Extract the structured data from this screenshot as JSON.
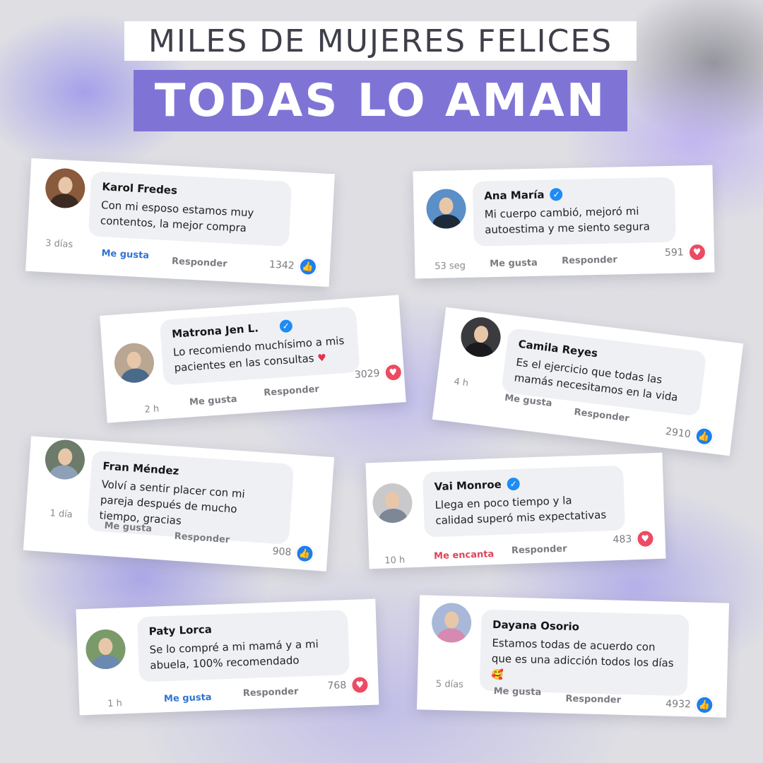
{
  "header": {
    "subtitle": "MILES DE MUJERES FELICES",
    "title": "TODAS LO AMAN"
  },
  "colors": {
    "accent": "#7f74d6",
    "like": "#1c7ef0",
    "love": "#ec4b63",
    "verified": "#1d8cf5"
  },
  "actions": {
    "like": "Me gusta",
    "love": "Me encanta",
    "reply": "Responder"
  },
  "comments": [
    {
      "name": "Karol Fredes",
      "verified": false,
      "text": "Con mi esposo estamos muy contentos, la mejor compra",
      "emoji": "",
      "time": "3 días",
      "action_label": "Me gusta",
      "action_state": "liked",
      "reply": "Responder",
      "count": "1342",
      "reaction": "like"
    },
    {
      "name": "Ana María",
      "verified": true,
      "text": "Mi cuerpo cambió, mejoró mi autoestima y me siento segura",
      "emoji": "",
      "time": "53 seg",
      "action_label": "Me gusta",
      "action_state": "none",
      "reply": "Responder",
      "count": "591",
      "reaction": "love"
    },
    {
      "name": "Matrona Jen L.",
      "verified": true,
      "text": "Lo recomiendo muchísimo a mis pacientes en las consultas",
      "emoji": "♥",
      "time": "2 h",
      "action_label": "Me gusta",
      "action_state": "none",
      "reply": "Responder",
      "count": "3029",
      "reaction": "love"
    },
    {
      "name": "Camila Reyes",
      "verified": false,
      "text": "Es el ejercicio que todas las mamás necesitamos en la vida",
      "emoji": "",
      "time": "4 h",
      "action_label": "Me gusta",
      "action_state": "none",
      "reply": "Responder",
      "count": "2910",
      "reaction": "like"
    },
    {
      "name": "Fran Méndez",
      "verified": false,
      "text": "Volví a sentir placer con mi pareja después de mucho tiempo, gracias",
      "emoji": "",
      "time": "1 día",
      "action_label": "Me gusta",
      "action_state": "none",
      "reply": "Responder",
      "count": "908",
      "reaction": "like"
    },
    {
      "name": "Vai Monroe",
      "verified": true,
      "text": "Llega en poco tiempo y la calidad superó mis expectativas",
      "emoji": "",
      "time": "10 h",
      "action_label": "Me encanta",
      "action_state": "loved",
      "reply": "Responder",
      "count": "483",
      "reaction": "love"
    },
    {
      "name": "Paty Lorca",
      "verified": false,
      "text": "Se lo compré a mi mamá y a mi abuela, 100% recomendado",
      "emoji": "",
      "time": "1 h",
      "action_label": "Me gusta",
      "action_state": "liked",
      "reply": "Responder",
      "count": "768",
      "reaction": "love"
    },
    {
      "name": "Dayana Osorio",
      "verified": false,
      "text": "Estamos todas de acuerdo con que es una adicción todos los días",
      "emoji": "🥰",
      "time": "5 días",
      "action_label": "Me gusta",
      "action_state": "none",
      "reply": "Responder",
      "count": "4932",
      "reaction": "like"
    }
  ]
}
